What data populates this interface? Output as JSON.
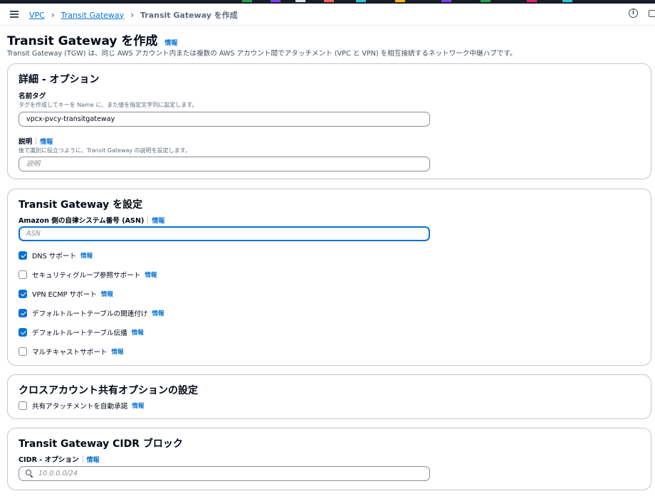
{
  "topstrip_colors": [
    "#1fa64a",
    "#7d3cff",
    "#e0e0e0",
    "#ff5e62",
    "#26c6da",
    "#ffb300",
    "#7d3cff",
    "#1fa64a",
    "#e91e63",
    "#26c6da"
  ],
  "breadcrumb": {
    "items": [
      {
        "label": "VPC"
      },
      {
        "label": "Transit Gateway"
      }
    ],
    "current": "Transit Gateway を作成"
  },
  "page": {
    "title": "Transit Gateway を作成",
    "info": "情報",
    "description": "Transit Gateway (TGW) は、同じ AWS アカウント内または複数の AWS アカウント間でアタッチメント (VPC と VPN) を相互接続するネットワーク中継ハブです。"
  },
  "details": {
    "title": "詳細 - オプション",
    "name_label": "名前タグ",
    "name_hint": "タグを作成してキーを Name に、また値を指定文字列に設定します。",
    "name_value": "vpcx-pvcy-transitgateway",
    "desc_label": "説明",
    "desc_info": "情報",
    "desc_hint": "後で識別に役立つように、Transit Gateway の説明を設定します。",
    "desc_placeholder": "説明"
  },
  "configure": {
    "title": "Transit Gateway を設定",
    "asn_label": "Amazon 側の自律システム番号 (ASN)",
    "asn_info": "情報",
    "asn_placeholder": "ASN",
    "checkboxes": [
      {
        "label": "DNS サポート",
        "info": "情報",
        "checked": true
      },
      {
        "label": "セキュリティグループ参照サポート",
        "info": "情報",
        "checked": false
      },
      {
        "label": "VPN ECMP サポート",
        "info": "情報",
        "checked": true
      },
      {
        "label": "デフォルトルートテーブルの関連付け",
        "info": "情報",
        "checked": true
      },
      {
        "label": "デフォルトルートテーブル伝播",
        "info": "情報",
        "checked": true
      },
      {
        "label": "マルチキャストサポート",
        "info": "情報",
        "checked": false
      }
    ]
  },
  "cross_account": {
    "title": "クロスアカウント共有オプションの設定",
    "checkbox": {
      "label": "共有アタッチメントを自動承諾",
      "info": "情報",
      "checked": false
    }
  },
  "cidr": {
    "title": "Transit Gateway CIDR ブロック",
    "label": "CIDR - オプション",
    "info": "情報",
    "placeholder": "10.0.0.0/24"
  }
}
